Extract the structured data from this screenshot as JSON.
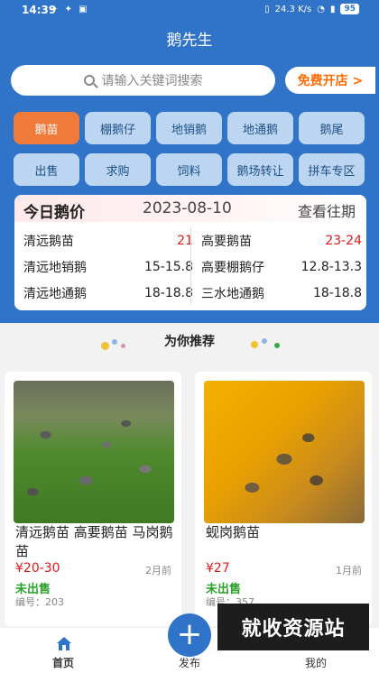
{
  "status": {
    "time": "14:39",
    "net_speed": "24.3 K/s",
    "battery": "95"
  },
  "app": {
    "title": "鹅先生"
  },
  "search": {
    "placeholder": "请输入关键词搜索"
  },
  "open_shop": {
    "label": "免费开店 >"
  },
  "categories": [
    {
      "label": "鹅苗",
      "active": true
    },
    {
      "label": "棚鹅仔"
    },
    {
      "label": "地销鹅"
    },
    {
      "label": "地通鹅"
    },
    {
      "label": "鹅尾"
    },
    {
      "label": "出售"
    },
    {
      "label": "求购"
    },
    {
      "label": "饲料"
    },
    {
      "label": "鹅场转让"
    },
    {
      "label": "拼车专区"
    }
  ],
  "price": {
    "title": "今日鹅价",
    "date": "2023-08-10",
    "history_label": "查看往期",
    "left": [
      {
        "name": "清远鹅苗",
        "value": "21",
        "red": true
      },
      {
        "name": "清远地销鹅",
        "value": "15-15.8"
      },
      {
        "name": "清远地通鹅",
        "value": "18-18.8"
      }
    ],
    "right": [
      {
        "name": "高要鹅苗",
        "value": "23-24",
        "red": true
      },
      {
        "name": "高要棚鹅仔",
        "value": "12.8-13.3"
      },
      {
        "name": "三水地通鹅",
        "value": "18-18.8"
      }
    ]
  },
  "recommend": {
    "title": "为你推荐"
  },
  "listings": [
    {
      "name": "清远鹅苗 高要鹅苗 马岗鹅苗",
      "price": "¥20-30",
      "ago": "2月前",
      "status": "未出售",
      "serial": "编号：203"
    },
    {
      "name": "蚬岗鹅苗",
      "price": "¥27",
      "ago": "1月前",
      "status": "未出售",
      "serial": "编号：357"
    }
  ],
  "tabs": {
    "home": "首页",
    "publish": "发布",
    "mine": "我的"
  },
  "watermark": "就收资源站",
  "colors": {
    "primary": "#2f74c8",
    "accent": "#f07a3a",
    "price_red": "#e21818",
    "unsold_green": "#2aa12a"
  }
}
